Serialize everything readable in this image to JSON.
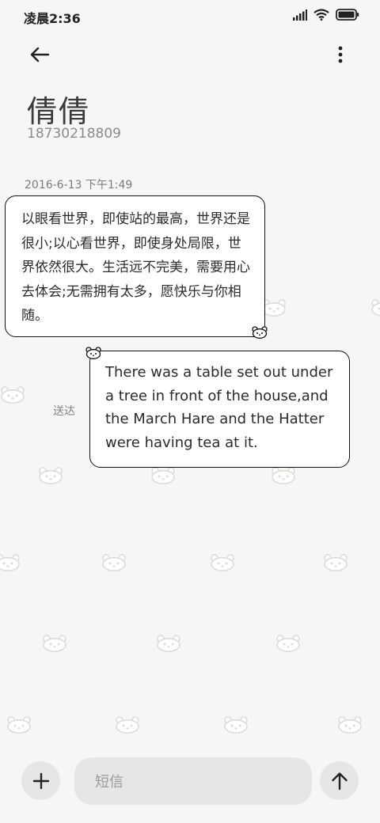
{
  "status_bar": {
    "time": "凌晨2:36",
    "icons": [
      "signal-icon",
      "wifi-icon",
      "battery-icon"
    ]
  },
  "header": {
    "back_icon": "back-arrow-icon",
    "menu_icon": "more-vertical-icon",
    "contact_name": "倩倩",
    "contact_phone": "18730218809"
  },
  "conversation": {
    "timestamp": "2016-6-13 下午1:49",
    "messages": [
      {
        "direction": "received",
        "text": "以眼看世界，即使站的最高，世界还是很小;以心看世界，即使身处局限，世界依然很大。生活远不完美，需要用心去体会;无需拥有太多，愿快乐与你相随。"
      },
      {
        "direction": "sent",
        "text": "There was a table set out under a tree in front of the house,and the March Hare and the Hatter were having tea at it.",
        "status": "送达"
      }
    ]
  },
  "composer": {
    "add_icon": "plus-icon",
    "placeholder": "短信",
    "value": "",
    "send_icon": "arrow-up-icon"
  },
  "theme": {
    "background": "#f7f6f4",
    "bubble_border": "#111111",
    "control_bg": "#e7e6e4"
  }
}
